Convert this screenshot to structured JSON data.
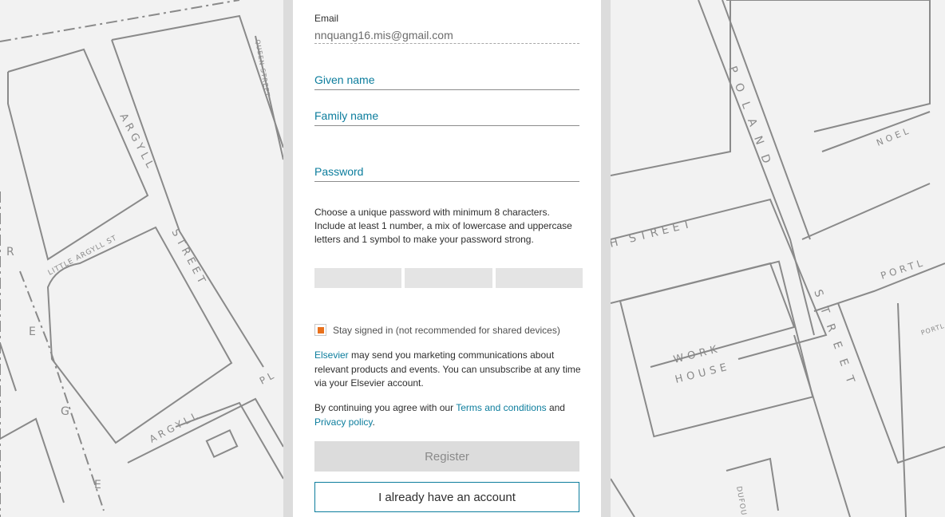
{
  "form": {
    "email_label": "Email",
    "email_value": "nnquang16.mis@gmail.com",
    "given_name_label": "Given name",
    "family_name_label": "Family name",
    "password_label": "Password",
    "password_hint": "Choose a unique password with minimum 8 characters. Include at least 1 number, a mix of lowercase and uppercase letters and 1 symbol to make your password strong.",
    "password_strength_segments": 3,
    "stay_signed_in_label": "Stay signed in (not recommended for shared devices)",
    "stay_signed_in_checked": true,
    "marketing": {
      "link": "Elsevier",
      "text": " may send you marketing communications about relevant products and events. You can unsubscribe at any time via your Elsevier account."
    },
    "terms": {
      "prefix": "By continuing you agree with our ",
      "terms_link": "Terms and conditions",
      "middle": " and",
      "privacy_link": "Privacy policy",
      "suffix": "."
    },
    "register_button": "Register",
    "account_button": "I already have an account"
  },
  "map_labels": {
    "left": [
      "ARGYLL",
      "LITTLE ARGYLL ST",
      "STREET",
      "ARGYLL",
      "QUEEN STREET",
      "R",
      "E",
      "G",
      "E",
      "PL"
    ],
    "right": [
      "POLAND",
      "STREET",
      "H STREET",
      "NOEL",
      "WORK",
      "HOUSE",
      "PORTL",
      "PORTL",
      "DUFOU"
    ]
  },
  "colors": {
    "accent": "#0c7d9d",
    "checkbox": "#e9711c",
    "map_lines": "#8a8a8a"
  }
}
